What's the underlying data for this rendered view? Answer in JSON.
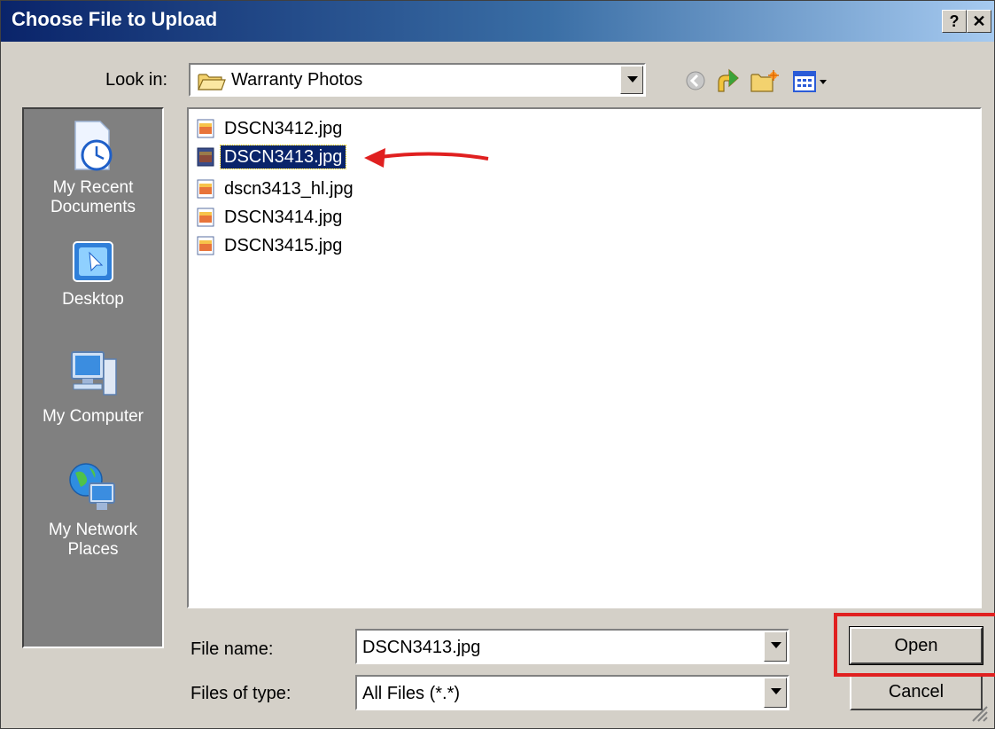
{
  "window": {
    "title": "Choose File to Upload",
    "help_label": "?",
    "close_label": "✕"
  },
  "lookin": {
    "label": "Look in:",
    "value": "Warranty Photos"
  },
  "places": [
    {
      "label": "My Recent Documents",
      "icon": "recent-documents-icon"
    },
    {
      "label": "Desktop",
      "icon": "desktop-icon"
    },
    {
      "label": "My Computer",
      "icon": "my-computer-icon"
    },
    {
      "label": "My Network Places",
      "icon": "network-places-icon"
    }
  ],
  "files": [
    {
      "name": "DSCN3412.jpg",
      "selected": false
    },
    {
      "name": "DSCN3413.jpg",
      "selected": true
    },
    {
      "name": "dscn3413_hl.jpg",
      "selected": false
    },
    {
      "name": "DSCN3414.jpg",
      "selected": false
    },
    {
      "name": "DSCN3415.jpg",
      "selected": false
    }
  ],
  "filename": {
    "label": "File name:",
    "value": "DSCN3413.jpg"
  },
  "filetype": {
    "label": "Files of type:",
    "value": "All Files (*.*)"
  },
  "buttons": {
    "open": "Open",
    "cancel": "Cancel"
  },
  "colors": {
    "titlebar": "#0a246a",
    "selection": "#0a246a",
    "annotation": "#e02020",
    "dialog_bg": "#d4d0c8",
    "places_bg": "#808080"
  }
}
